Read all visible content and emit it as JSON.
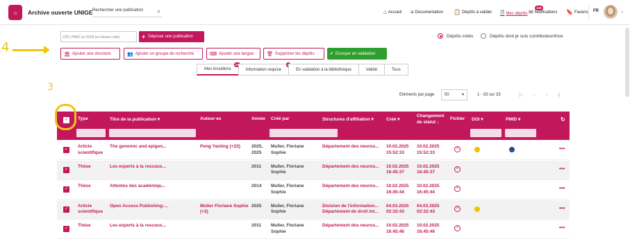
{
  "header": {
    "brand": "Archive ouverte UNIGE",
    "search_placeholder": "Rechercher une publication",
    "nav": [
      {
        "label": "Accueil",
        "icon": "home-icon",
        "glyph": "⌂"
      },
      {
        "label": "Documentation",
        "icon": "menu-icon",
        "glyph": "≡"
      },
      {
        "label": "Dépôts à valider",
        "icon": "clipboard-icon",
        "glyph": "📋"
      },
      {
        "label": "Mes dépôts",
        "icon": "document-icon",
        "glyph": "🗎"
      },
      {
        "label": "Notifications",
        "icon": "mail-icon",
        "glyph": "✉",
        "badge": "120"
      },
      {
        "label": "Favoris",
        "icon": "bookmark-icon",
        "glyph": "🔖"
      }
    ],
    "lang": "FR"
  },
  "toolbar": {
    "id_placeholder": "DOI, PMID ou ISSN (ou laissez vide)",
    "deposit_label": "Déposer une publication",
    "radio_created": "Dépôts créés",
    "radio_contrib": "Dépôts dont je suis contributeur/trice",
    "actions": [
      {
        "label": "Ajouter une structure",
        "glyph": "🏛"
      },
      {
        "label": "Ajouter un groupe de recherche",
        "glyph": "👥"
      },
      {
        "label": "Ajouter une langue",
        "glyph": "⌨"
      },
      {
        "label": "Supprimer les dépôts",
        "glyph": "🗑"
      }
    ],
    "validate_label": "Envoyer en validation"
  },
  "annotations": {
    "four": "4",
    "three": "3"
  },
  "tabs": [
    {
      "label": "Mes brouillons",
      "badge": "33"
    },
    {
      "label": "Information requise",
      "badge": "4"
    },
    {
      "label": "En validation à la bibliothèque"
    },
    {
      "label": "Validé"
    },
    {
      "label": "Tous"
    }
  ],
  "pagination": {
    "label": "Eléments par page",
    "per_page": "50",
    "range": "1 - 33 sur 33"
  },
  "table": {
    "headers": {
      "type": "Type",
      "title": "Titre de la publication",
      "authors": "Auteur·es",
      "year": "Année",
      "created_by": "Créé par",
      "structures": "Structures d'affiliation",
      "created": "Créé",
      "changed": "Changement de statut ↓",
      "file": "Fichier",
      "doi": "DOI",
      "pmid": "PMID"
    },
    "rows": [
      {
        "type": "Article scientifique",
        "title": "The genomic and epigen...",
        "authors": "Peng Yanling (+22)",
        "year": "2025, 2025",
        "created_by": "Muller, Floriane Sophie",
        "structures": "Département des neuros...",
        "created": "10.02.2025 15:52:33",
        "changed": "10.02.2025 15:52:33",
        "doi": true,
        "pmid": true
      },
      {
        "type": "Thèse",
        "title": "Les experts à la rescous...",
        "authors": "",
        "year": "2011",
        "created_by": "Muller, Floriane Sophie",
        "structures": "Département des neuros...",
        "created": "10.02.2025 16:45:37",
        "changed": "10.02.2025 16:45:37",
        "doi": false,
        "pmid": false
      },
      {
        "type": "Thèse",
        "title": "Attentes des académiqu...",
        "authors": "",
        "year": "2014",
        "created_by": "Muller, Floriane Sophie",
        "structures": "Département des neuros...",
        "created": "10.02.2025 16:45:44",
        "changed": "10.02.2025 16:45:44",
        "doi": false,
        "pmid": false
      },
      {
        "type": "Article scientifique",
        "title": "Open Access Publishing:...",
        "authors": "Muller Floriane Sophie (+2)",
        "year": "2025",
        "created_by": "Muller, Floriane Sophie",
        "structures": "Division de l'information... Département de droit int...",
        "created": "04.03.2025 02:32:43",
        "changed": "04.03.2025 02:32:43",
        "doi": true,
        "pmid": false
      },
      {
        "type": "Thèse",
        "title": "Les experts à la rescous...",
        "authors": "",
        "year": "2011",
        "created_by": "Muller, Floriane Sophie",
        "structures": "Département des neuros...",
        "created": "10.02.2025 16:45:46",
        "changed": "10.02.2025 16:45:46",
        "doi": false,
        "pmid": false
      }
    ]
  }
}
